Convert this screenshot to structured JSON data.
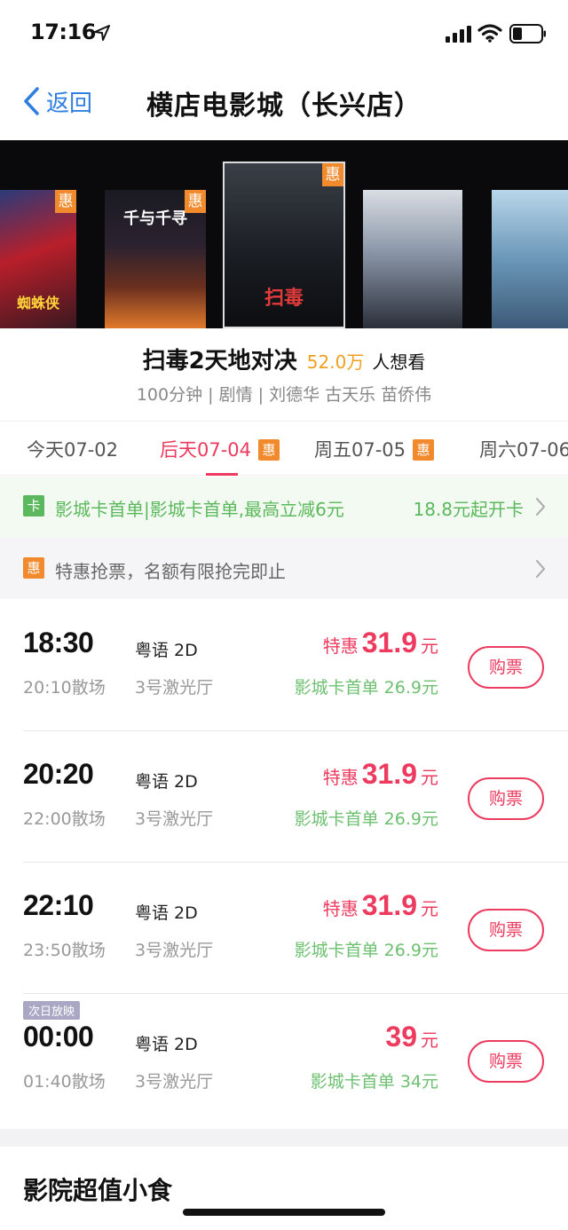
{
  "status_bar": {
    "time": "17:16"
  },
  "nav": {
    "back_label": "返回",
    "title": "横店电影城（长兴店）"
  },
  "posters": [
    {
      "name": "spiderman",
      "badge": "惠",
      "caption": "蜘蛛侠"
    },
    {
      "name": "spirited-away",
      "badge": "惠",
      "caption": "千与千寻"
    },
    {
      "name": "drug-lords",
      "badge": "惠",
      "caption": "扫毒"
    },
    {
      "name": "poster-4",
      "badge": "",
      "caption": ""
    },
    {
      "name": "poster-5",
      "badge": "",
      "caption": ""
    }
  ],
  "movie": {
    "title": "扫毒2天地对决",
    "want_count": "52.0万",
    "want_label": "人想看",
    "meta": "100分钟 | 剧情 | 刘德华 古天乐 苗侨伟"
  },
  "date_tabs": [
    {
      "label": "今天07-02",
      "badge": ""
    },
    {
      "label": "后天07-04",
      "badge": "惠"
    },
    {
      "label": "周五07-05",
      "badge": "惠"
    },
    {
      "label": "周六07-06",
      "badge": ""
    }
  ],
  "card_promo": {
    "badge": "卡",
    "text": "影城卡首单|影城卡首单,最高立减6元",
    "cta": "18.8元起开卡"
  },
  "deal_promo": {
    "badge": "惠",
    "text": "特惠抢票，名额有限抢完即止"
  },
  "showtimes": [
    {
      "start": "18:30",
      "end": "20:10散场",
      "lang": "粤语 2D",
      "hall": "3号激光厅",
      "price_label": "特惠",
      "price": "31.9",
      "unit": "元",
      "card_price": "影城卡首单 26.9元",
      "buy": "购票",
      "tag": ""
    },
    {
      "start": "20:20",
      "end": "22:00散场",
      "lang": "粤语 2D",
      "hall": "3号激光厅",
      "price_label": "特惠",
      "price": "31.9",
      "unit": "元",
      "card_price": "影城卡首单 26.9元",
      "buy": "购票",
      "tag": ""
    },
    {
      "start": "22:10",
      "end": "23:50散场",
      "lang": "粤语 2D",
      "hall": "3号激光厅",
      "price_label": "特惠",
      "price": "31.9",
      "unit": "元",
      "card_price": "影城卡首单 26.9元",
      "buy": "购票",
      "tag": ""
    },
    {
      "start": "00:00",
      "end": "01:40散场",
      "lang": "粤语 2D",
      "hall": "3号激光厅",
      "price_label": "",
      "price": "39",
      "unit": "元",
      "card_price": "影城卡首单 34元",
      "buy": "购票",
      "tag": "次日放映"
    }
  ],
  "snacks": {
    "title": "影院超值小食"
  },
  "colors": {
    "accent": "#ec3b5f",
    "link": "#2f7fe0",
    "card_green": "#5cb85c",
    "deal_orange": "#f08a2c",
    "want_orange": "#f0a020"
  }
}
